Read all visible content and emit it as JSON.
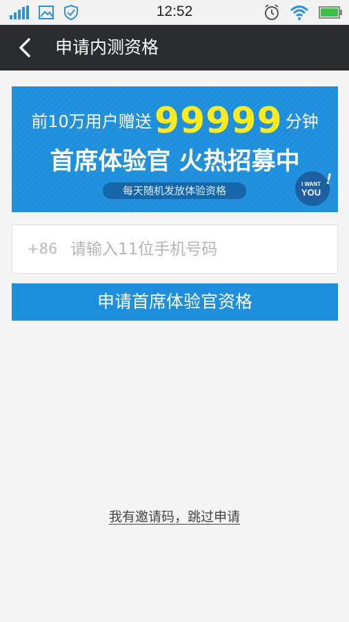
{
  "status_bar": {
    "time": "12:52",
    "icons": [
      "signal-icon",
      "image-icon",
      "shield-check-icon",
      "alarm-icon",
      "wifi-icon",
      "battery-icon"
    ]
  },
  "nav": {
    "title": "申请内测资格",
    "back_icon": "chevron-left-icon"
  },
  "banner": {
    "line1_prefix": "前10万用户赠送",
    "line1_number": "99999",
    "line1_suffix": "分钟",
    "line2": "首席体验官 火热招募中",
    "pill": "每天随机发放体验资格",
    "badge_line1": "I WANT",
    "badge_line2": "YOU",
    "badge_mark": "!"
  },
  "form": {
    "country_code": "+86",
    "phone_placeholder": "请输入11位手机号码",
    "phone_value": "",
    "apply_label": "申请首席体验官资格"
  },
  "footer": {
    "skip_label": "我有邀请码，跳过申请"
  },
  "colors": {
    "nav_bg": "#2a2c30",
    "accent": "#1e8fdc",
    "highlight": "#ffeb1a",
    "page_bg": "#f4f4f4"
  }
}
